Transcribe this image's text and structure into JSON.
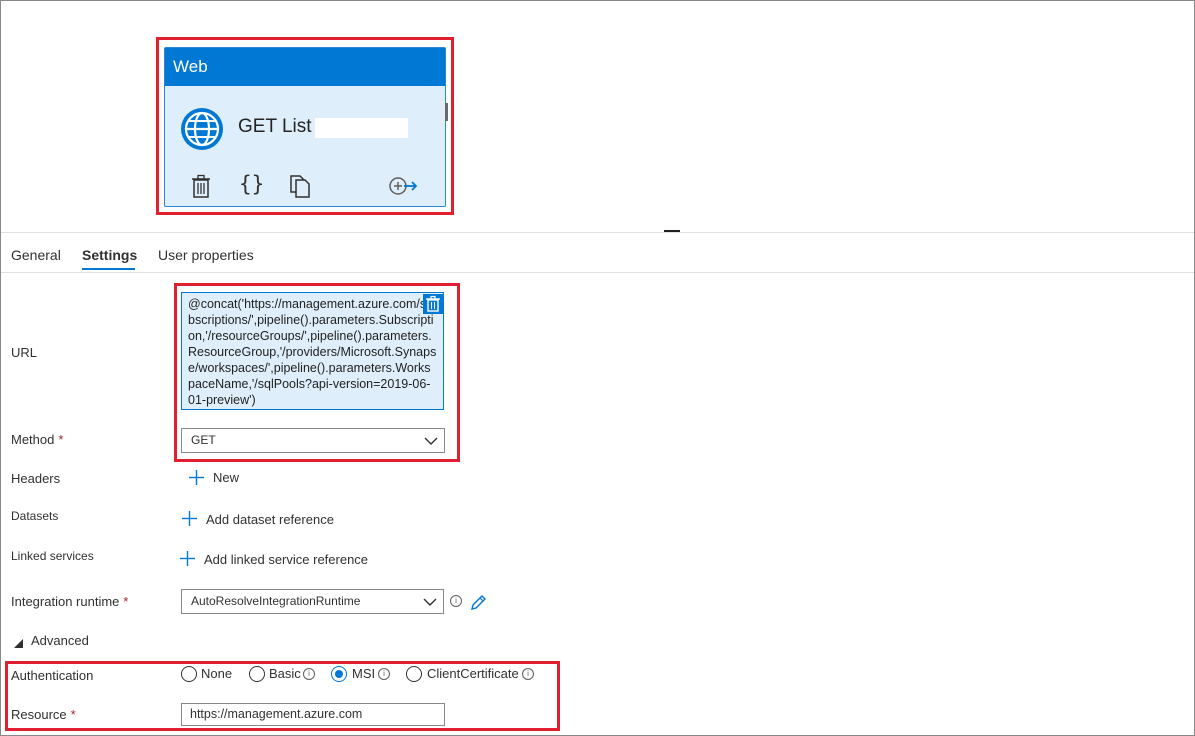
{
  "activity": {
    "type_label": "Web",
    "name": "GET List"
  },
  "tabs": [
    {
      "label": "General"
    },
    {
      "label": "Settings"
    },
    {
      "label": "User properties"
    }
  ],
  "form": {
    "url_label": "URL",
    "url_value": "@concat('https://management.azure.com/subscriptions/',pipeline().parameters.Subscription,'/resourceGroups/',pipeline().parameters.ResourceGroup,'/providers/Microsoft.Synapse/workspaces/',pipeline().parameters.WorkspaceName,'/sqlPools?api-version=2019-06-01-preview')",
    "method_label": "Method",
    "method_value": "GET",
    "headers_label": "Headers",
    "headers_new": "New",
    "datasets_label": "Datasets",
    "datasets_add": "Add dataset reference",
    "linked_label": "Linked services",
    "linked_add": "Add linked service reference",
    "ir_label": "Integration runtime",
    "ir_value": "AutoResolveIntegrationRuntime",
    "advanced_label": "Advanced",
    "auth_label": "Authentication",
    "auth_options": [
      "None",
      "Basic",
      "MSI",
      "ClientCertificate"
    ],
    "auth_selected": "MSI",
    "resource_label": "Resource",
    "resource_value": "https://management.azure.com",
    "required_marker": "*",
    "info_glyph": "i"
  },
  "colors": {
    "accent": "#0078d4",
    "highlight": "#e02030",
    "card_bg": "#deeffb"
  },
  "icons": [
    "globe-icon",
    "delete-icon",
    "code-icon",
    "copy-icon",
    "add-output-icon",
    "chevron-down-icon",
    "plus-icon",
    "info-icon",
    "edit-icon",
    "triangle-icon"
  ]
}
